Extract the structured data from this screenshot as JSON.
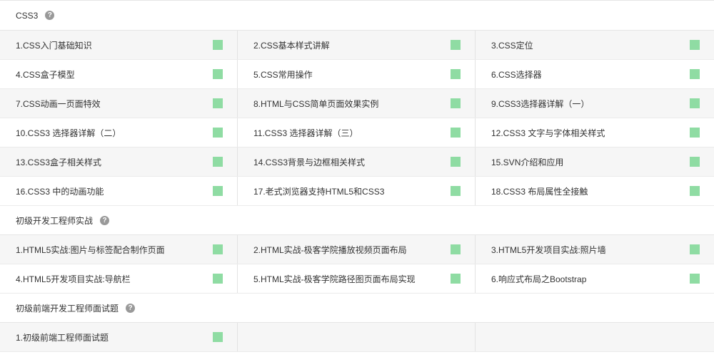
{
  "colors": {
    "status_complete": "#8fdca3",
    "row_alt": "#f6f6f6",
    "border": "#e6e6e6",
    "text": "#333333",
    "help_icon": "#999999"
  },
  "help_icon": "?",
  "sections": [
    {
      "title": "CSS3",
      "items": [
        "1.CSS入门基础知识",
        "2.CSS基本样式讲解",
        "3.CSS定位",
        "4.CSS盒子模型",
        "5.CSS常用操作",
        "6.CSS选择器",
        "7.CSS动画一页面特效",
        "8.HTML与CSS简单页面效果实例",
        "9.CSS3选择器详解（一）",
        "10.CSS3 选择器详解（二）",
        "11.CSS3 选择器详解（三）",
        "12.CSS3 文字与字体相关样式",
        "13.CSS3盒子相关样式",
        "14.CSS3背景与边框相关样式",
        "15.SVN介绍和应用",
        "16.CSS3 中的动画功能",
        "17.老式浏览器支持HTML5和CSS3",
        "18.CSS3 布局属性全接触"
      ]
    },
    {
      "title": "初级开发工程师实战",
      "items": [
        "1.HTML5实战:图片与标签配合制作页面",
        "2.HTML实战-极客学院播放视频页面布局",
        "3.HTML5开发项目实战:照片墙",
        "4.HTML5开发项目实战:导航栏",
        "5.HTML实战-极客学院路径图页面布局实现",
        "6.响应式布局之Bootstrap"
      ]
    },
    {
      "title": "初级前端开发工程师面试题",
      "items": [
        "1.初级前端工程师面试题"
      ]
    }
  ]
}
